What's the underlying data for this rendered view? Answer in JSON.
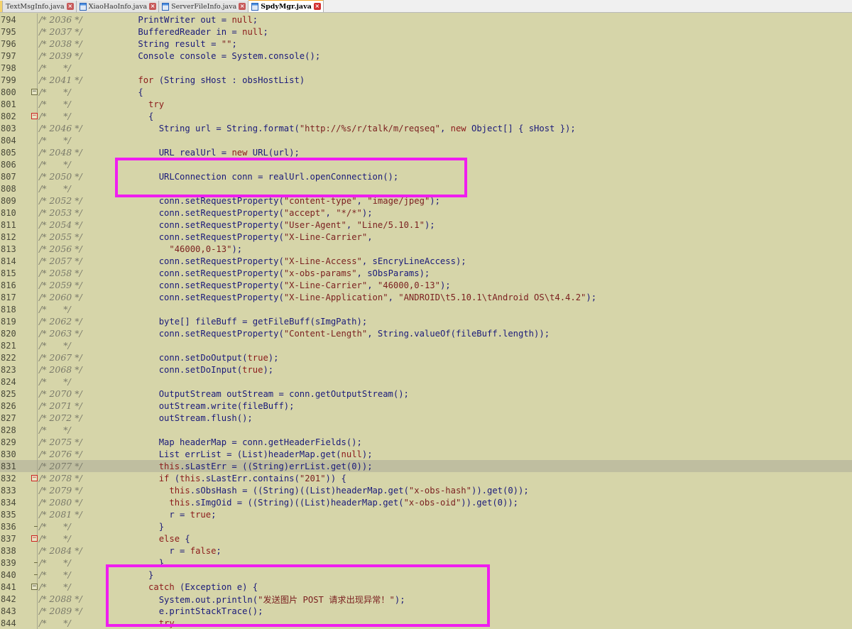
{
  "tabs": [
    {
      "label": "TextMsgInfo.java",
      "active": false
    },
    {
      "label": "XiaoHaoInfo.java",
      "active": false
    },
    {
      "label": "ServerFileInfo.java",
      "active": false
    },
    {
      "label": "SpdyMgr.java",
      "active": true
    }
  ],
  "colors": {
    "background": "#d6d5a9",
    "highlight_box": "#f01df0",
    "current_line": "#bfbea0"
  },
  "lines": [
    {
      "n": "794",
      "c": "/* 2036 */",
      "t": "    PrintWriter out = null;"
    },
    {
      "n": "795",
      "c": "/* 2037 */",
      "t": "    BufferedReader in = null;"
    },
    {
      "n": "796",
      "c": "/* 2038 */",
      "t": "    String result = \"\";"
    },
    {
      "n": "797",
      "c": "/* 2039 */",
      "t": "    Console console = System.console();"
    },
    {
      "n": "798",
      "c": "/*      */",
      "t": ""
    },
    {
      "n": "799",
      "c": "/* 2041 */",
      "t": "    for (String sHost : obsHostList)"
    },
    {
      "n": "800",
      "c": "/*      */",
      "t": "    {",
      "fold": "open"
    },
    {
      "n": "801",
      "c": "/*      */",
      "t": "      try"
    },
    {
      "n": "802",
      "c": "/*      */",
      "t": "      {",
      "fold": "open-red"
    },
    {
      "n": "803",
      "c": "/* 2046 */",
      "t": "        String url = String.format(\"http://%s/r/talk/m/reqseq\", new Object[] { sHost });"
    },
    {
      "n": "804",
      "c": "/*      */",
      "t": ""
    },
    {
      "n": "805",
      "c": "/* 2048 */",
      "t": "        URL realUrl = new URL(url);"
    },
    {
      "n": "806",
      "c": "/*      */",
      "t": ""
    },
    {
      "n": "807",
      "c": "/* 2050 */",
      "t": "        URLConnection conn = realUrl.openConnection();"
    },
    {
      "n": "808",
      "c": "/*      */",
      "t": ""
    },
    {
      "n": "809",
      "c": "/* 2052 */",
      "t": "        conn.setRequestProperty(\"content-type\", \"image/jpeg\");"
    },
    {
      "n": "810",
      "c": "/* 2053 */",
      "t": "        conn.setRequestProperty(\"accept\", \"*/*\");"
    },
    {
      "n": "811",
      "c": "/* 2054 */",
      "t": "        conn.setRequestProperty(\"User-Agent\", \"Line/5.10.1\");"
    },
    {
      "n": "812",
      "c": "/* 2055 */",
      "t": "        conn.setRequestProperty(\"X-Line-Carrier\","
    },
    {
      "n": "813",
      "c": "/* 2056 */",
      "t": "          \"46000,0-13\");"
    },
    {
      "n": "814",
      "c": "/* 2057 */",
      "t": "        conn.setRequestProperty(\"X-Line-Access\", sEncryLineAccess);"
    },
    {
      "n": "815",
      "c": "/* 2058 */",
      "t": "        conn.setRequestProperty(\"x-obs-params\", sObsParams);"
    },
    {
      "n": "816",
      "c": "/* 2059 */",
      "t": "        conn.setRequestProperty(\"X-Line-Carrier\", \"46000,0-13\");"
    },
    {
      "n": "817",
      "c": "/* 2060 */",
      "t": "        conn.setRequestProperty(\"X-Line-Application\", \"ANDROID\\t5.10.1\\tAndroid OS\\t4.4.2\");"
    },
    {
      "n": "818",
      "c": "/*      */",
      "t": ""
    },
    {
      "n": "819",
      "c": "/* 2062 */",
      "t": "        byte[] fileBuff = getFileBuff(sImgPath);"
    },
    {
      "n": "820",
      "c": "/* 2063 */",
      "t": "        conn.setRequestProperty(\"Content-Length\", String.valueOf(fileBuff.length));"
    },
    {
      "n": "821",
      "c": "/*      */",
      "t": ""
    },
    {
      "n": "822",
      "c": "/* 2067 */",
      "t": "        conn.setDoOutput(true);"
    },
    {
      "n": "823",
      "c": "/* 2068 */",
      "t": "        conn.setDoInput(true);"
    },
    {
      "n": "824",
      "c": "/*      */",
      "t": ""
    },
    {
      "n": "825",
      "c": "/* 2070 */",
      "t": "        OutputStream outStream = conn.getOutputStream();"
    },
    {
      "n": "826",
      "c": "/* 2071 */",
      "t": "        outStream.write(fileBuff);"
    },
    {
      "n": "827",
      "c": "/* 2072 */",
      "t": "        outStream.flush();"
    },
    {
      "n": "828",
      "c": "/*      */",
      "t": ""
    },
    {
      "n": "829",
      "c": "/* 2075 */",
      "t": "        Map headerMap = conn.getHeaderFields();"
    },
    {
      "n": "830",
      "c": "/* 2076 */",
      "t": "        List errList = (List)headerMap.get(null);"
    },
    {
      "n": "831",
      "c": "/* 2077 */",
      "t": "        this.sLastErr = ((String)errList.get(0));",
      "current": true
    },
    {
      "n": "832",
      "c": "/* 2078 */",
      "t": "        if (this.sLastErr.contains(\"201\")) {",
      "fold": "open-red"
    },
    {
      "n": "833",
      "c": "/* 2079 */",
      "t": "          this.sObsHash = ((String)((List)headerMap.get(\"x-obs-hash\")).get(0));"
    },
    {
      "n": "834",
      "c": "/* 2080 */",
      "t": "          this.sImgOid = ((String)((List)headerMap.get(\"x-obs-oid\")).get(0));"
    },
    {
      "n": "835",
      "c": "/* 2081 */",
      "t": "          r = true;"
    },
    {
      "n": "836",
      "c": "/*      */",
      "t": "        }",
      "fold": "end"
    },
    {
      "n": "837",
      "c": "/*      */",
      "t": "        else {",
      "fold": "open-red"
    },
    {
      "n": "838",
      "c": "/* 2084 */",
      "t": "          r = false;"
    },
    {
      "n": "839",
      "c": "/*      */",
      "t": "        }",
      "fold": "end"
    },
    {
      "n": "840",
      "c": "/*      */",
      "t": "      }",
      "fold": "end"
    },
    {
      "n": "841",
      "c": "/*      */",
      "t": "      catch (Exception e) {",
      "fold": "open"
    },
    {
      "n": "842",
      "c": "/* 2088 */",
      "t": "        System.out.println(\"发送图片 POST 请求出现异常！\");"
    },
    {
      "n": "843",
      "c": "/* 2089 */",
      "t": "        e.printStackTrace();"
    },
    {
      "n": "844",
      "c": "/*      */",
      "t": "        try"
    }
  ]
}
